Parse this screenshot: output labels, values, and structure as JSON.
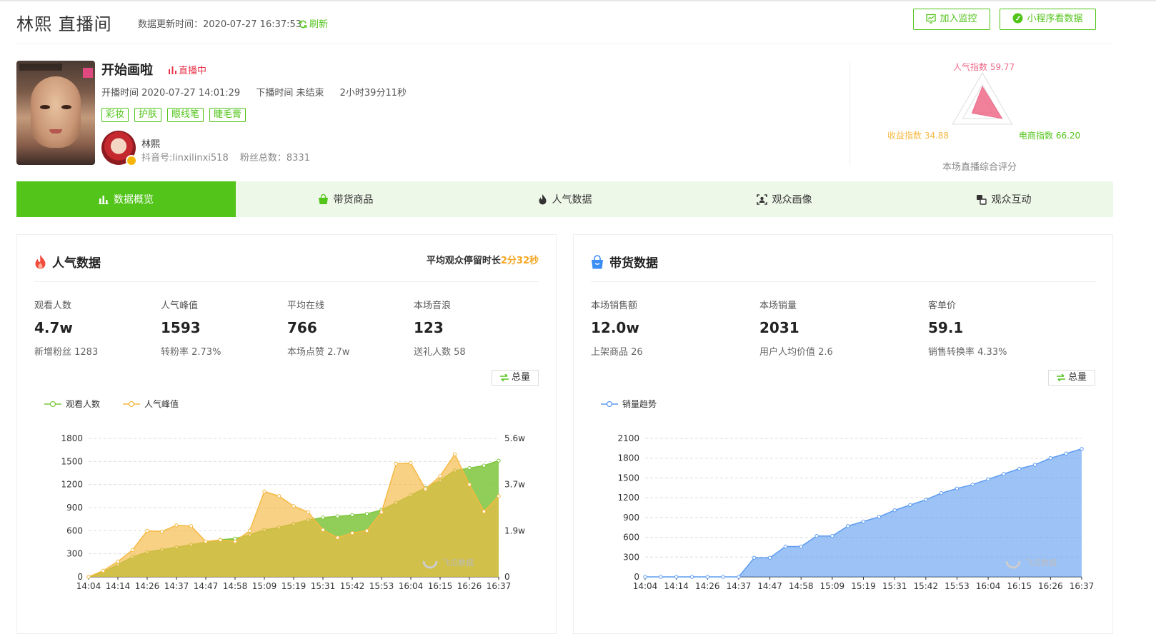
{
  "header": {
    "title": "林熙  直播间",
    "update_time": "数据更新时间：2020-07-27 16:37:53",
    "refresh": "刷新",
    "btn_monitor": "加入监控",
    "btn_miniapp": "小程序看数据"
  },
  "live": {
    "title": "开始画啦",
    "status": "直播中",
    "start": "开播时间 2020-07-27 14:01:29",
    "end": "下播时间 未结束",
    "duration": "2小时39分11秒",
    "tags": [
      "彩妆",
      "护肤",
      "眼线笔",
      "睫毛膏"
    ],
    "host_name": "林熙",
    "douyin_id": "抖音号:linxilinxi518",
    "fans": "粉丝总数：8331"
  },
  "radar": {
    "popularity": "人气指数 59.77",
    "income": "收益指数 34.88",
    "ecommerce": "电商指数 66.20",
    "label": "本场直播综合评分",
    "values": {
      "popularity": 59.77,
      "income": 34.88,
      "ecommerce": 66.2
    },
    "colors": {
      "popularity": "#ef6b8a",
      "income": "#f5b942",
      "ecommerce": "#52c41a"
    }
  },
  "tabs": [
    "数据概览",
    "带货商品",
    "人气数据",
    "观众画像",
    "观众互动"
  ],
  "popularity_panel": {
    "title": "人气数据",
    "avg_stay_label": "平均观众停留时长",
    "avg_stay_value": "2分32秒",
    "stats": [
      {
        "label": "观看人数",
        "value": "4.7w",
        "sub": "新增粉丝 1283"
      },
      {
        "label": "人气峰值",
        "value": "1593",
        "sub": "转粉率 2.73%"
      },
      {
        "label": "平均在线",
        "value": "766",
        "sub": "本场点赞 2.7w"
      },
      {
        "label": "本场音浪",
        "value": "123",
        "sub": "送礼人数 58"
      }
    ],
    "total_btn": "总量"
  },
  "sales_panel": {
    "title": "带货数据",
    "stats": [
      {
        "label": "本场销售额",
        "value": "12.0w",
        "sub": "上架商品 26"
      },
      {
        "label": "本场销量",
        "value": "2031",
        "sub": "用户人均价值 2.6"
      },
      {
        "label": "客单价",
        "value": "59.1",
        "sub": "销售转换率 4.33%"
      }
    ],
    "total_btn": "总量"
  },
  "watermark": "飞瓜数据",
  "colors": {
    "accent": "#52c41a",
    "green_series": "#7ec63c",
    "orange_series": "#f5b942",
    "blue_series": "#5b9bf0"
  },
  "chart_data": [
    {
      "type": "area",
      "x": [
        "14:04",
        "14:09",
        "14:14",
        "14:20",
        "14:26",
        "14:31",
        "14:37",
        "14:42",
        "14:47",
        "14:53",
        "14:58",
        "15:04",
        "15:09",
        "15:14",
        "15:19",
        "15:25",
        "15:31",
        "15:36",
        "15:42",
        "15:47",
        "15:53",
        "15:58",
        "16:04",
        "16:10",
        "16:15",
        "16:21",
        "16:26",
        "16:32",
        "16:37"
      ],
      "x_ticks": [
        "14:04",
        "14:14",
        "14:26",
        "14:37",
        "14:47",
        "14:58",
        "15:09",
        "15:19",
        "15:31",
        "15:42",
        "15:53",
        "16:04",
        "16:15",
        "16:26",
        "16:37"
      ],
      "series": [
        {
          "name": "观看人数",
          "axis": "right",
          "values": [
            0,
            2000,
            5000,
            8000,
            10000,
            11000,
            12000,
            13000,
            14000,
            15000,
            15500,
            17000,
            19000,
            20000,
            21500,
            23000,
            24000,
            24500,
            25000,
            25500,
            27000,
            30000,
            33000,
            36000,
            39000,
            43000,
            44000,
            45000,
            47000
          ]
        },
        {
          "name": "人气峰值",
          "axis": "left",
          "values": [
            0,
            80,
            200,
            350,
            600,
            590,
            670,
            660,
            460,
            480,
            460,
            600,
            1110,
            1050,
            920,
            840,
            610,
            510,
            570,
            600,
            840,
            1470,
            1480,
            1140,
            1310,
            1593,
            1200,
            850,
            1050
          ]
        }
      ],
      "y_left": {
        "ticks": [
          0,
          300,
          600,
          900,
          1200,
          1500,
          1800
        ],
        "range": [
          0,
          1800
        ]
      },
      "y_right": {
        "ticks": [
          "0",
          "1.9w",
          "3.7w",
          "5.6w"
        ],
        "range": [
          0,
          56000
        ]
      }
    },
    {
      "type": "area",
      "x": [
        "14:04",
        "14:09",
        "14:14",
        "14:20",
        "14:26",
        "14:31",
        "14:37",
        "14:42",
        "14:47",
        "14:53",
        "14:58",
        "15:04",
        "15:09",
        "15:14",
        "15:19",
        "15:25",
        "15:31",
        "15:36",
        "15:42",
        "15:47",
        "15:53",
        "15:58",
        "16:04",
        "16:10",
        "16:15",
        "16:21",
        "16:26",
        "16:32",
        "16:37"
      ],
      "x_ticks": [
        "14:04",
        "14:14",
        "14:26",
        "14:37",
        "14:47",
        "14:58",
        "15:09",
        "15:19",
        "15:31",
        "15:42",
        "15:53",
        "16:04",
        "16:15",
        "16:26",
        "16:37"
      ],
      "series": [
        {
          "name": "销量趋势",
          "values": [
            0,
            0,
            0,
            0,
            0,
            0,
            0,
            290,
            290,
            460,
            460,
            620,
            620,
            770,
            840,
            910,
            1010,
            1090,
            1170,
            1270,
            1340,
            1400,
            1480,
            1560,
            1640,
            1700,
            1800,
            1870,
            1940
          ]
        }
      ],
      "y_left": {
        "ticks": [
          0,
          300,
          600,
          900,
          1200,
          1500,
          1800,
          2100
        ],
        "range": [
          0,
          2100
        ]
      }
    }
  ]
}
